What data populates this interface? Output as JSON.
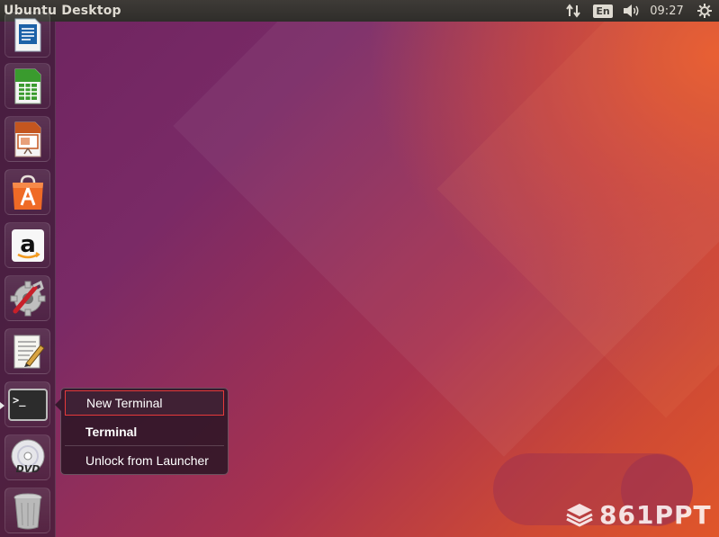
{
  "top_panel": {
    "title": "Ubuntu Desktop",
    "keyboard_layout": "En",
    "clock": "09:27"
  },
  "launcher": {
    "items": [
      {
        "name": "libreoffice-writer",
        "icon": "writer-icon"
      },
      {
        "name": "libreoffice-calc",
        "icon": "calc-icon"
      },
      {
        "name": "libreoffice-impress",
        "icon": "impress-icon"
      },
      {
        "name": "ubuntu-software",
        "icon": "software-center-icon"
      },
      {
        "name": "amazon",
        "icon": "amazon-icon"
      },
      {
        "name": "system-settings",
        "icon": "settings-icon"
      },
      {
        "name": "text-editor",
        "icon": "text-editor-icon"
      },
      {
        "name": "terminal",
        "icon": "terminal-icon",
        "running": true
      },
      {
        "name": "dvd",
        "icon": "dvd-icon"
      },
      {
        "name": "trash",
        "icon": "trash-icon"
      }
    ]
  },
  "quicklist": {
    "items": [
      {
        "label": "New Terminal",
        "highlighted": true
      },
      {
        "label": "Terminal",
        "bold": true
      },
      {
        "label": "Unlock from Launcher"
      }
    ]
  },
  "watermark": {
    "text": "861PPT"
  },
  "colors": {
    "ubuntu_orange": "#e95420",
    "aubergine": "#5e2750",
    "panel": "#3c3b37",
    "highlight_border": "#e53a3a"
  }
}
